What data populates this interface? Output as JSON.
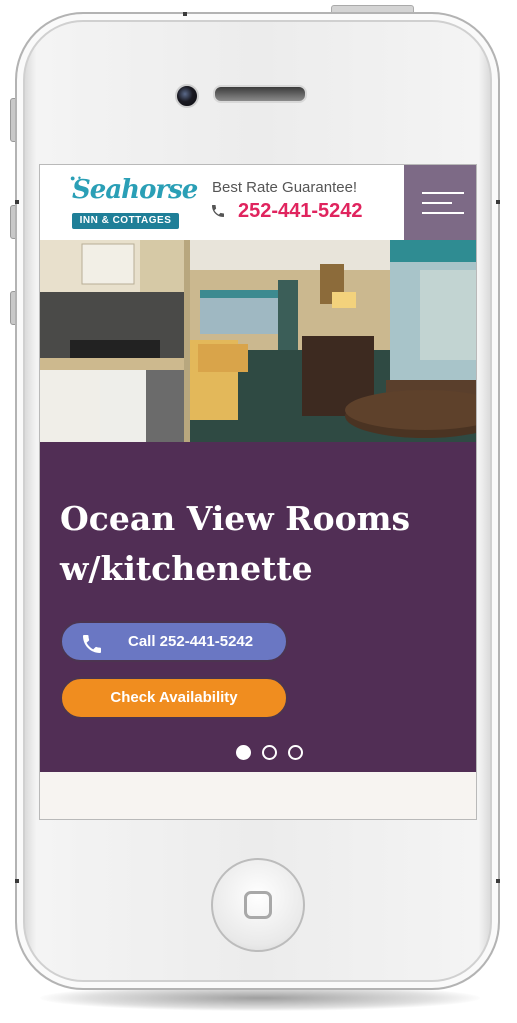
{
  "header": {
    "logo_script": "Seahorse",
    "logo_band": "INN & COTTAGES",
    "tagline": "Best Rate Guarantee!",
    "phone": "252-441-5242",
    "menu_icon": "hamburger-menu-icon"
  },
  "hero": {
    "title": "Ocean View Rooms w/kitchenette",
    "call_button": "Call 252-441-5242",
    "call_icon": "phone-icon",
    "availability_button": "Check Availability",
    "slide_count": 3,
    "active_slide": 1
  },
  "colors": {
    "brand_teal": "#2a9fb6",
    "phone_red": "#e0245e",
    "hero_purple": "#512e55",
    "menu_mauve": "#7d6a86",
    "call_blue": "#6a77c3",
    "availability_orange": "#f08d1f"
  }
}
